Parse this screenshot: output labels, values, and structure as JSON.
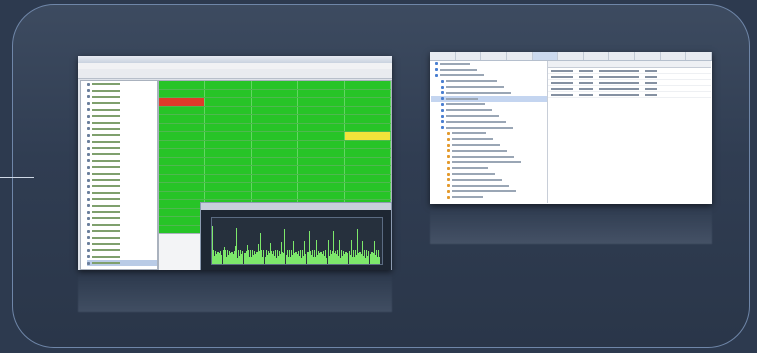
{
  "colors": {
    "page_bg": "#2d3a4f",
    "card_border": "#6f86a8",
    "grid_green": "#27c427",
    "alert_red": "#e03a2a",
    "warn_yellow": "#f2e33a",
    "chart_line": "#7de86b"
  },
  "thumbnails": [
    {
      "name": "monitoring-app-screenshot",
      "selected_tree_item": true,
      "grid_rows": 20,
      "grid_cols": 5
    },
    {
      "name": "configuration-app-screenshot",
      "tab_count": 11,
      "tree_rows": 24,
      "table_rows": 5
    }
  ]
}
